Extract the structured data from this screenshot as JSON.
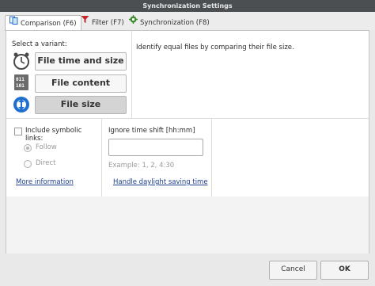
{
  "window": {
    "title": "Synchronization Settings"
  },
  "tabs": [
    {
      "label": "Comparison (F6)",
      "icon": "comparison-icon",
      "active": true
    },
    {
      "label": "Filter (F7)",
      "icon": "filter-funnel-icon",
      "active": false
    },
    {
      "label": "Synchronization (F8)",
      "icon": "gear-icon",
      "active": false
    }
  ],
  "variants": {
    "label": "Select a variant:",
    "items": [
      {
        "label": "File time and size",
        "icon": "clock-icon",
        "selected": false
      },
      {
        "label": "File content",
        "icon": "binary-file-icon",
        "selected": false
      },
      {
        "label": "File size",
        "icon": "file-size-icon",
        "selected": true
      }
    ]
  },
  "description": "Identify equal files by comparing their file size.",
  "symlinks": {
    "label": "Include symbolic links:",
    "checked": false,
    "options": [
      {
        "label": "Follow",
        "selected": true
      },
      {
        "label": "Direct",
        "selected": false
      }
    ],
    "more_info": "More information"
  },
  "time_shift": {
    "label": "Ignore time shift [hh:mm]",
    "value": "",
    "example": "Example:  1, 2, 4:30",
    "dst_link": "Handle daylight saving time"
  },
  "footer": {
    "cancel": "Cancel",
    "ok": "OK"
  },
  "colors": {
    "titlebar": "#4b4f52",
    "link": "#1d3f8a",
    "accent_blue": "#1e6fd0",
    "filter_red": "#c0282d",
    "gear_green": "#3d8b2f"
  }
}
